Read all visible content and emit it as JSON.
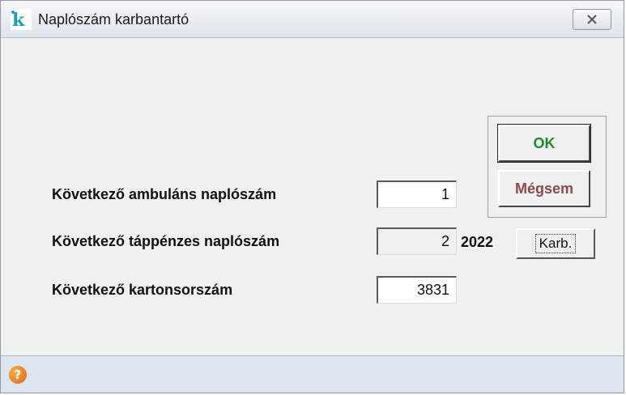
{
  "window": {
    "title": "Naplószám karbantartó",
    "close_icon": "close-icon",
    "app_icon": "app-logo-icon"
  },
  "form": {
    "ambulans": {
      "label": "Következő ambuláns naplószám",
      "value": "1"
    },
    "tappenzes": {
      "label": "Következő táppénzes naplószám",
      "value": "2",
      "year": "2022"
    },
    "karton": {
      "label": "Következő kartonsorszám",
      "value": "3831"
    },
    "karb_label": "Karb."
  },
  "buttons": {
    "ok_label": "OK",
    "cancel_label": "Mégsem"
  },
  "colors": {
    "ok_text": "#1e8a2e",
    "cancel_text": "#8b4a4a",
    "statusbar": "#dde6ef"
  },
  "statusbar": {
    "help_icon": "help-icon"
  }
}
